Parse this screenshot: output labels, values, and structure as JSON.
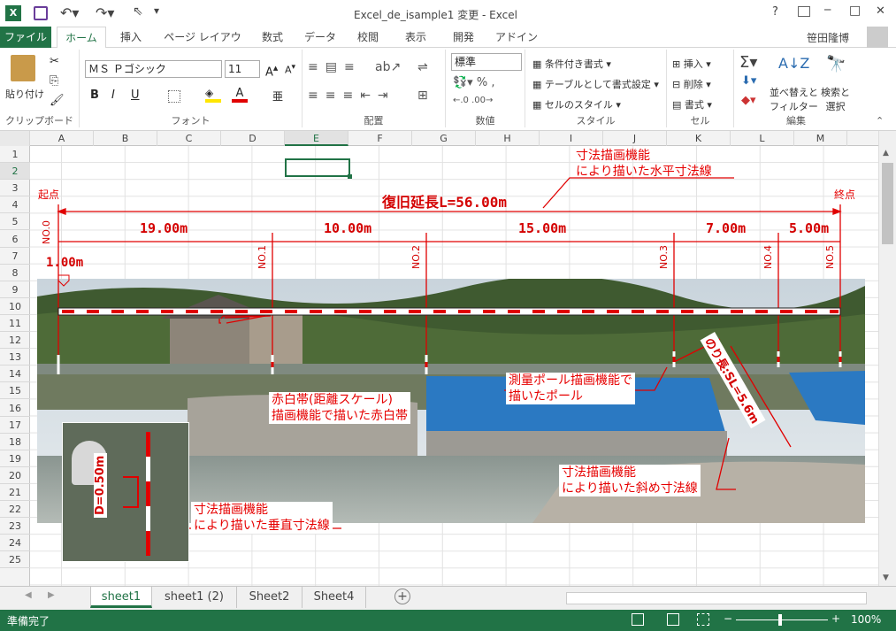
{
  "titlebar": {
    "title": "Excel_de_isample1 変更 - Excel",
    "help": "?",
    "minimize": "─",
    "maximize": "□",
    "close": "✕"
  },
  "tabs": [
    "ファイル",
    "ホーム",
    "挿入",
    "ページ レイアウト",
    "数式",
    "データ",
    "校閲",
    "表示",
    "開発",
    "アドイン"
  ],
  "user": "笹田隆博",
  "ribbon": {
    "clipboard": {
      "label": "クリップボード",
      "paste": "貼り付け"
    },
    "font": {
      "label": "フォント",
      "name": "ＭＳ Ｐゴシック",
      "size": "11",
      "bold": "B",
      "italic": "I",
      "underline": "U"
    },
    "align": {
      "label": "配置"
    },
    "number": {
      "label": "数値",
      "format": "標準"
    },
    "style": {
      "label": "スタイル",
      "cond": "条件付き書式",
      "table": "テーブルとして書式設定",
      "cell": "セルのスタイル"
    },
    "cells": {
      "label": "セル",
      "insert": "挿入",
      "delete": "削除",
      "format": "書式"
    },
    "edit": {
      "label": "編集",
      "sort": "並べ替えと",
      "sort2": "フィルター",
      "find": "検索と",
      "find2": "選択"
    }
  },
  "columns": [
    "A",
    "B",
    "C",
    "D",
    "E",
    "F",
    "G",
    "H",
    "I",
    "J",
    "K",
    "L",
    "M"
  ],
  "rows": [
    "1",
    "2",
    "3",
    "4",
    "5",
    "6",
    "7",
    "8",
    "9",
    "10",
    "11",
    "12",
    "13",
    "14",
    "15",
    "16",
    "17",
    "18",
    "19",
    "20",
    "21",
    "22",
    "23",
    "24",
    "25"
  ],
  "sheets": [
    "sheet1",
    "sheet1 (2)",
    "Sheet2",
    "Sheet4"
  ],
  "status": {
    "ready": "準備完了",
    "zoom": "100%"
  },
  "drawing": {
    "total": "復旧延長L=56.00m",
    "start": "起点",
    "end": "終点",
    "segments": [
      "19.00m",
      "10.00m",
      "15.00m",
      "7.00m",
      "5.00m"
    ],
    "stations": [
      "NO.0",
      "NO.1",
      "NO.2",
      "NO.3",
      "NO.4",
      "NO.5"
    ],
    "small": "1.00m",
    "slope": "のり長:SL=5.6m",
    "vertical": "D=0.50m",
    "notes": {
      "horiz1": "寸法描画機能",
      "horiz2": "により描いた水平寸法線",
      "tape1": "赤白帯(距離スケール)",
      "tape2": "描画機能で描いた赤白帯",
      "pole1": "測量ポール描画機能で",
      "pole2": "描いたポール",
      "diag1": "寸法描画機能",
      "diag2": "により描いた斜め寸法線",
      "vert1": "寸法描画機能",
      "vert2": "により描いた垂直寸法線"
    }
  },
  "colors": {
    "excel_green": "#217346",
    "dim_red": "#e00000"
  }
}
